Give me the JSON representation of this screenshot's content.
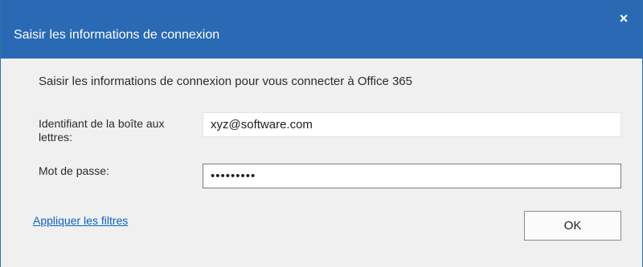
{
  "window": {
    "title": "Saisir les informations de connexion",
    "close_label": "×"
  },
  "form": {
    "instruction": "Saisir les informations de connexion pour vous connecter à Office 365",
    "mailbox_label": "Identifiant de la boîte aux lettres:",
    "mailbox_value": "xyz@software.com",
    "password_label": "Mot de passe:",
    "password_value": "password1"
  },
  "footer": {
    "filters_link": "Appliquer les filtres",
    "ok_label": "OK"
  },
  "colors": {
    "titlebar": "#2a69b3",
    "link": "#0b63c5"
  }
}
